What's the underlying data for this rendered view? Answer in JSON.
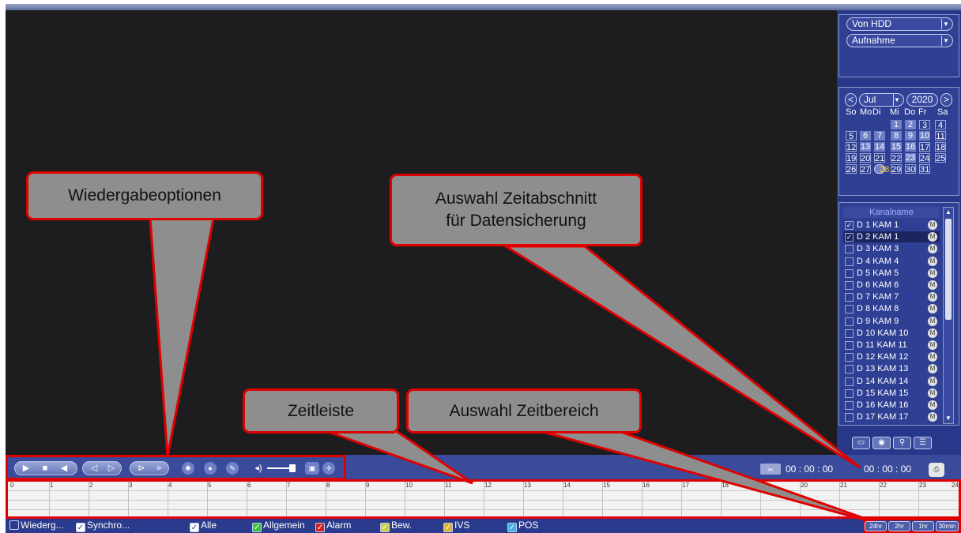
{
  "source": {
    "selected": "Von HDD"
  },
  "rectype": {
    "selected": "Aufnahme"
  },
  "calendar": {
    "month": "Jul",
    "year": "2020",
    "weekdays": [
      "So",
      "Mo",
      "Di",
      "Mi",
      "Do",
      "Fr",
      "Sa"
    ],
    "weeks": [
      [
        "",
        "",
        "",
        "1",
        "2",
        "3",
        "4"
      ],
      [
        "5",
        "6",
        "7",
        "8",
        "9",
        "10",
        "11"
      ],
      [
        "12",
        "13",
        "14",
        "15",
        "16",
        "17",
        "18"
      ],
      [
        "19",
        "20",
        "21",
        "22",
        "23",
        "24",
        "25"
      ],
      [
        "26",
        "27",
        "28",
        "29",
        "30",
        "31",
        ""
      ]
    ],
    "recorded_days": [
      "1",
      "2",
      "6",
      "7",
      "8",
      "9",
      "10",
      "13",
      "14",
      "15",
      "16",
      "23"
    ],
    "selected_day": "28"
  },
  "channels": {
    "header": "Kanalname",
    "items": [
      {
        "label": "D 1 KAM 1",
        "checked": true
      },
      {
        "label": "D 2 KAM 1",
        "checked": true
      },
      {
        "label": "D 3 KAM 3",
        "checked": false
      },
      {
        "label": "D 4 KAM 4",
        "checked": false
      },
      {
        "label": "D 5 KAM 5",
        "checked": false
      },
      {
        "label": "D 6 KAM 6",
        "checked": false
      },
      {
        "label": "D 7 KAM 7",
        "checked": false
      },
      {
        "label": "D 8 KAM 8",
        "checked": false
      },
      {
        "label": "D 9 KAM 9",
        "checked": false
      },
      {
        "label": "D 10 KAM 10",
        "checked": false
      },
      {
        "label": "D 11 KAM 11",
        "checked": false
      },
      {
        "label": "D 12 KAM 12",
        "checked": false
      },
      {
        "label": "D 13 KAM 13",
        "checked": false
      },
      {
        "label": "D 14 KAM 14",
        "checked": false
      },
      {
        "label": "D 15 KAM 15",
        "checked": false
      },
      {
        "label": "D 16 KAM 16",
        "checked": false
      },
      {
        "label": "D 17 KAM 17",
        "checked": false
      }
    ],
    "badge": "M"
  },
  "time": {
    "start": "00 : 00 : 00",
    "end": "00 : 00 : 00"
  },
  "timeline": {
    "hours": [
      "0",
      "1",
      "2",
      "3",
      "4",
      "5",
      "6",
      "7",
      "8",
      "9",
      "10",
      "11",
      "12",
      "13",
      "14",
      "15",
      "16",
      "17",
      "18",
      "19",
      "20",
      "21",
      "22",
      "23",
      "24"
    ]
  },
  "bottom": {
    "options": [
      {
        "label": "Wiederg...",
        "checked": false,
        "color": "#2a3a8c"
      },
      {
        "label": "Synchro...",
        "checked": true,
        "color": "#ffffff"
      },
      {
        "label": "Alle",
        "checked": true,
        "color": "#ffffff"
      },
      {
        "label": "Allgemein",
        "checked": true,
        "color": "#3cbf3c"
      },
      {
        "label": "Alarm",
        "checked": true,
        "color": "#d02020"
      },
      {
        "label": "Bew.",
        "checked": true,
        "color": "#c8d040"
      },
      {
        "label": "IVS",
        "checked": true,
        "color": "#e0b030"
      },
      {
        "label": "POS",
        "checked": true,
        "color": "#40b0e0"
      }
    ],
    "zoom": [
      "24hr",
      "2hr",
      "1hr",
      "30min"
    ]
  },
  "callouts": {
    "playback": "Wiedergabeoptionen",
    "backup": "Auswahl Zeitabschnitt für Datensicherung",
    "timeline": "Zeitleiste",
    "range": "Auswahl Zeitbereich"
  }
}
